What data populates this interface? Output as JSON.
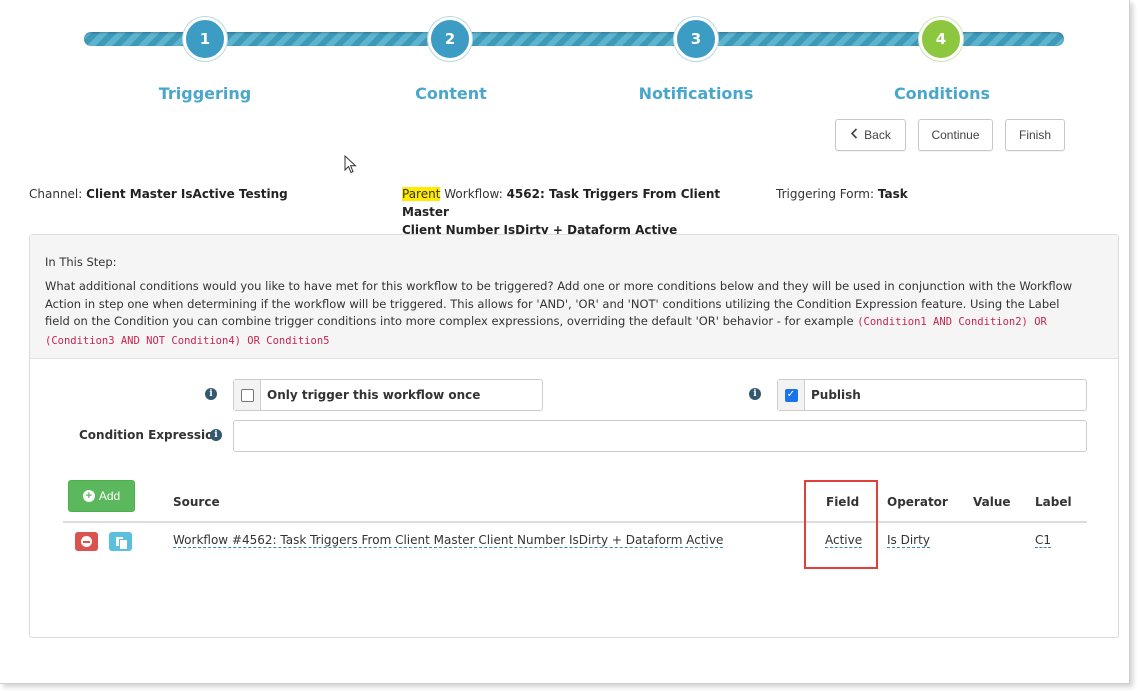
{
  "wizard": {
    "steps": [
      {
        "number": "1",
        "label": "Triggering"
      },
      {
        "number": "2",
        "label": "Content"
      },
      {
        "number": "3",
        "label": "Notifications"
      },
      {
        "number": "4",
        "label": "Conditions"
      }
    ],
    "current_step": 4,
    "colors": {
      "step": "#3d9cc4",
      "current": "#8dc63f",
      "label": "#4aa6cb"
    }
  },
  "nav": {
    "back_label": "Back",
    "continue_label": "Continue",
    "finish_label": "Finish"
  },
  "info": {
    "channel_label": "Channel:",
    "channel_value": "Client Master IsActive Testing",
    "parent_highlight": "Parent",
    "parent_label": "Workflow:",
    "parent_value_line1": "4562: Task Triggers From Client Master",
    "parent_value_line2": "Client Number IsDirty + Dataform Active",
    "triggering_form_label": "Triggering Form:",
    "triggering_form_value": "Task"
  },
  "step_help": {
    "title": "In This Step:",
    "text": "What additional conditions would you like to have met for this workflow to be triggered? Add one or more conditions below and they will be used in conjunction with the Workflow Action in step one when determining if the workflow will be triggered. This allows for 'AND', 'OR' and 'NOT' conditions utilizing the Condition Expression feature. Using the Label field on the Condition you can combine trigger conditions into more complex expressions, overriding the default 'OR' behavior - for example ",
    "example_code": "(Condition1 AND Condition2) OR (Condition3 AND NOT Condition4) OR Condition5"
  },
  "options": {
    "trigger_once_label": "Only trigger this workflow once",
    "trigger_once_checked": false,
    "publish_label": "Publish",
    "publish_checked": true,
    "condition_expression_label": "Condition Expression",
    "condition_expression_value": ""
  },
  "conditions_table": {
    "add_label": "Add",
    "columns": {
      "source": "Source",
      "field": "Field",
      "operator": "Operator",
      "value": "Value",
      "label": "Label"
    },
    "rows": [
      {
        "source": "Workflow #4562: Task Triggers From Client Master Client Number IsDirty + Dataform Active",
        "field": "Active",
        "operator": "Is Dirty",
        "value": "",
        "label": "C1"
      }
    ]
  }
}
